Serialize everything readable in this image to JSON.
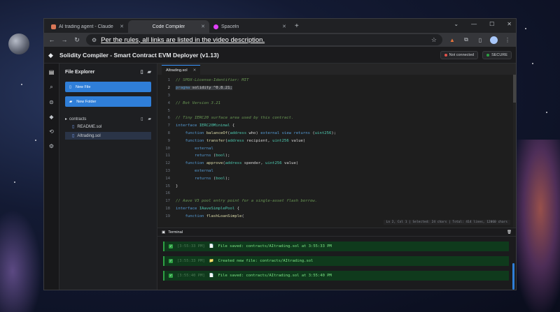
{
  "browser": {
    "tabs": [
      {
        "label": "AI trading agent - Claude",
        "favicon_color": "#d97757",
        "active": false
      },
      {
        "label": "Code Compiler",
        "favicon_color": "#5f6368",
        "active": true
      },
      {
        "label": "Spaceln",
        "favicon_color": "#e040fb",
        "active": false
      }
    ],
    "url": "Per the rules, all links are listed in the video description."
  },
  "app": {
    "title": "Solidity Compiler - Smart Contract EVM Deployer (v1.13)",
    "status_connection": "Not connected",
    "status_secure": "SECURE",
    "connection_color": "#e5534b",
    "secure_color": "#2ea043"
  },
  "explorer": {
    "title": "File Explorer",
    "new_file_label": "New File",
    "new_folder_label": "New Folder",
    "folder": "contracts",
    "files": [
      "README.sol",
      "AItrading.sol"
    ]
  },
  "editor": {
    "tab": "AItrading.sol",
    "status": "Ln 2, Col 1 | Selected: 24 chars | Total: 414 lines, 12060 chars"
  },
  "terminal": {
    "title": "Terminal",
    "entries": [
      {
        "time": "[3:55:33 PM]",
        "icon": "📄",
        "message": "File saved: contracts/AItrading.sol at 3:55:33 PM"
      },
      {
        "time": "[3:55:33 PM]",
        "icon": "📁",
        "message": "Created new file: contracts/AItrading.sol"
      },
      {
        "time": "[3:55:40 PM]",
        "icon": "📄",
        "message": "File saved: contracts/AItrading.sol at 3:55:40 PM"
      }
    ]
  }
}
